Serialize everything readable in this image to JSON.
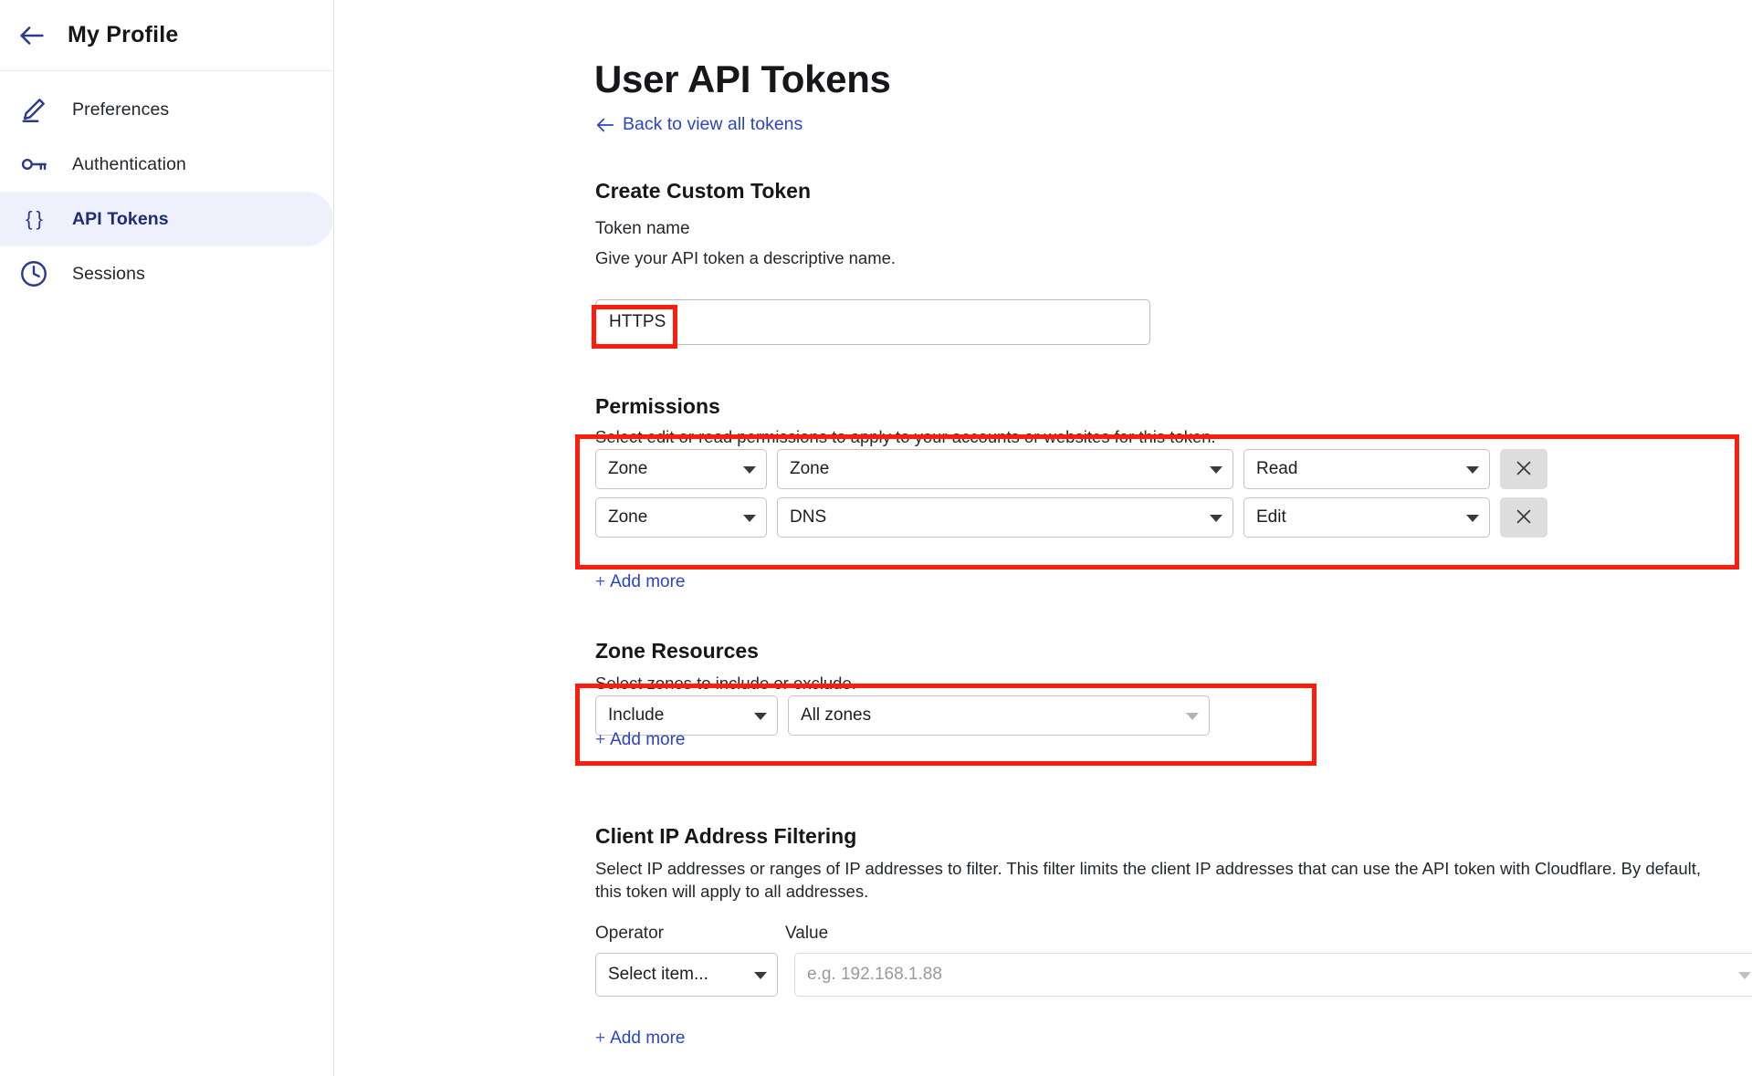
{
  "sidebar": {
    "back_icon": "arrow-left-icon",
    "title": "My Profile",
    "items": [
      {
        "label": "Preferences",
        "icon": "pencil-icon",
        "active": false
      },
      {
        "label": "Authentication",
        "icon": "key-icon",
        "active": false
      },
      {
        "label": "API Tokens",
        "icon": "braces-icon",
        "active": true
      },
      {
        "label": "Sessions",
        "icon": "clock-icon",
        "active": false
      }
    ],
    "active_pill_color": "#eef1fb",
    "accent_color": "#2c3a8c"
  },
  "main": {
    "page_title": "User API Tokens",
    "back_link": {
      "label": "Back to view all tokens",
      "icon": "arrow-left-icon"
    },
    "create_section_title": "Create Custom Token",
    "token_name": {
      "label": "Token name",
      "description": "Give your API token a descriptive name.",
      "value": "HTTPS",
      "placeholder": ""
    },
    "permissions": {
      "title": "Permissions",
      "description": "Select edit or read permissions to apply to your accounts or websites for this token.",
      "rows": [
        {
          "group": "Zone",
          "resource": "Zone",
          "level": "Read",
          "remove_icon": "close-icon"
        },
        {
          "group": "Zone",
          "resource": "DNS",
          "level": "Edit",
          "remove_icon": "close-icon"
        }
      ],
      "add_more": "Add more",
      "add_more_plus": "+"
    },
    "zone_resources": {
      "title": "Zone Resources",
      "description": "Select zones to include or exclude.",
      "rows": [
        {
          "mode": "Include",
          "scope": "All zones"
        }
      ],
      "add_more": "Add more",
      "add_more_plus": "+"
    },
    "client_ip": {
      "title": "Client IP Address Filtering",
      "description": "Select IP addresses or ranges of IP addresses to filter. This filter limits the client IP addresses that can use the API token with Cloudflare. By default, this token will apply to all addresses.",
      "operator_label": "Operator",
      "value_label": "Value",
      "operator_value": "Select item...",
      "value_placeholder": "e.g. 192.168.1.88",
      "value_current": "",
      "add_more": "Add more",
      "add_more_plus": "+"
    }
  },
  "annotations": {
    "highlight_color": "#fc1d0c",
    "boxes": [
      {
        "name": "token-name-highlight"
      },
      {
        "name": "permissions-highlight"
      },
      {
        "name": "zone-resources-highlight"
      }
    ]
  }
}
